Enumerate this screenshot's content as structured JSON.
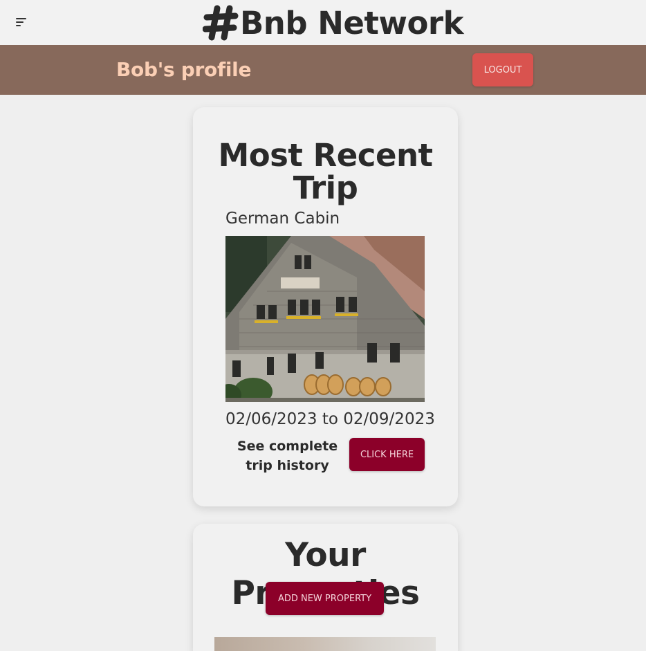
{
  "header": {
    "menu_icon": "menu-lines-icon",
    "logo_icon": "hashtag-icon",
    "brand": "Bnb Network"
  },
  "profile": {
    "title": "Bob's profile",
    "logout_label": "LOGOUT"
  },
  "recent_trip": {
    "heading": "Most Recent Trip",
    "property_name": "German Cabin",
    "dates": "02/06/2023 to 02/09/2023",
    "history_text": "See complete trip history",
    "history_button": "CLICK HERE"
  },
  "properties": {
    "heading": "Your Properties",
    "add_button": "ADD NEW PROPERTY"
  },
  "colors": {
    "profile_bar": "#87695b",
    "profile_title": "#fbcfb5",
    "logout": "#d9534f",
    "primary_button": "#8c0029"
  }
}
